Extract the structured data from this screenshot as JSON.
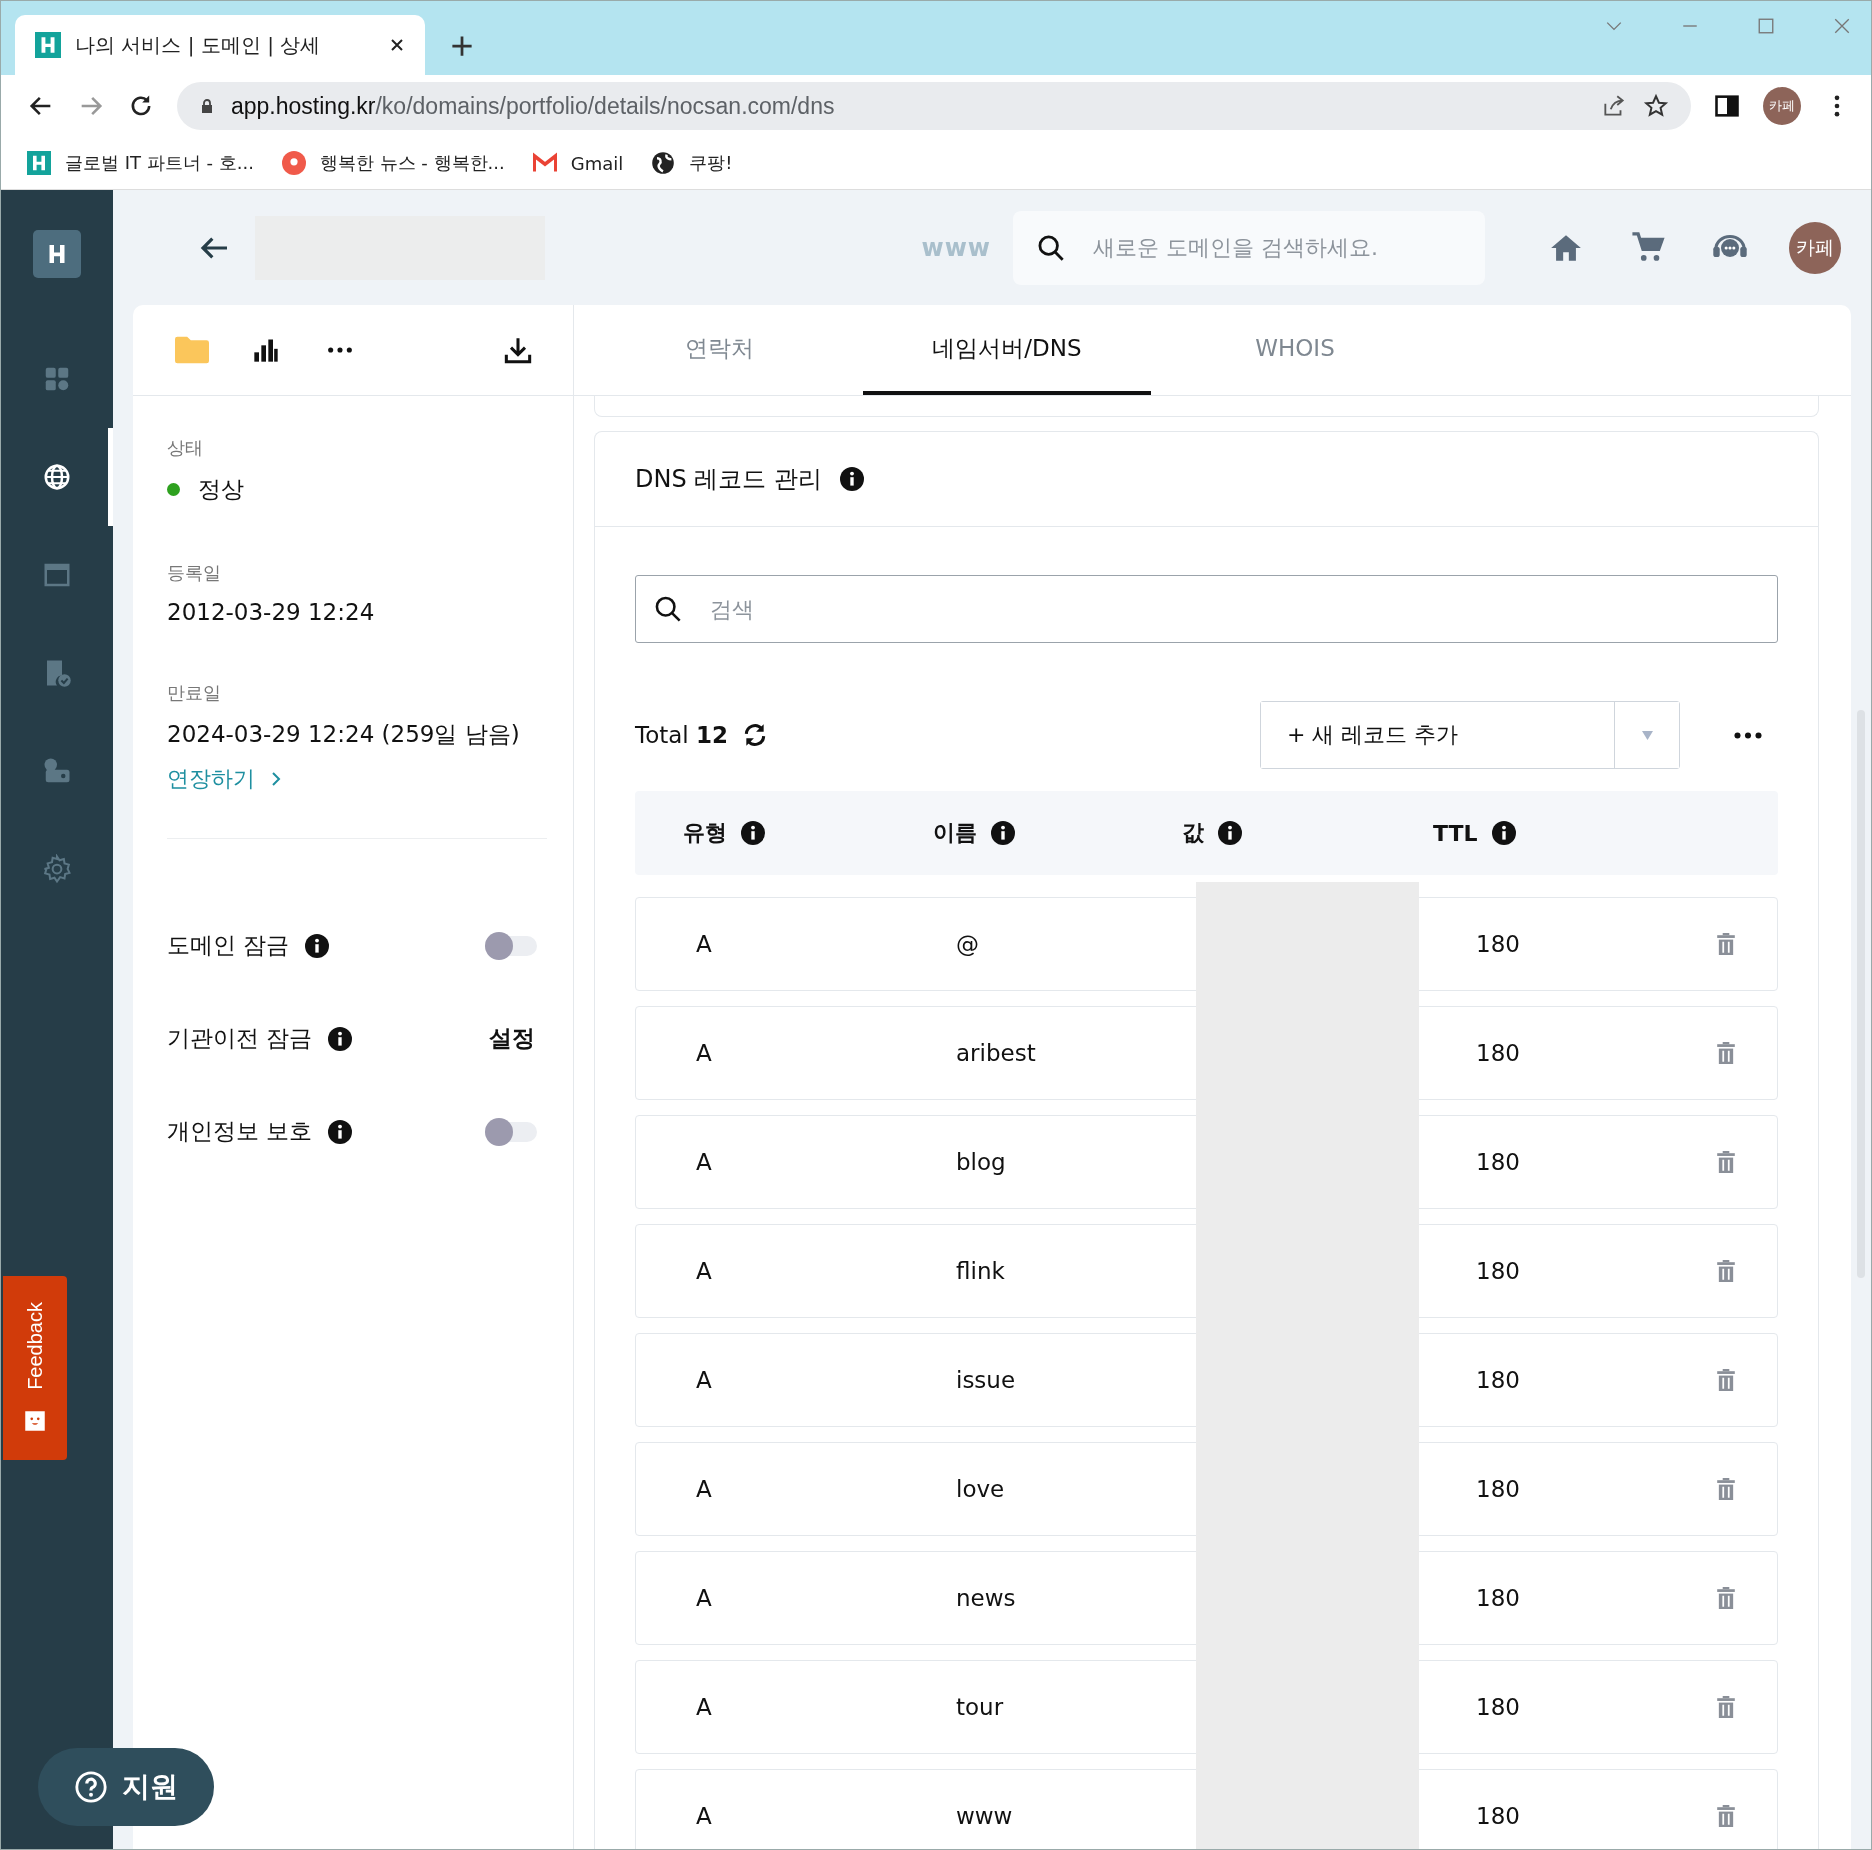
{
  "browser": {
    "tab_title": "나의 서비스 | 도메인 | 상세",
    "url_host": "app.hosting.kr",
    "url_path": "/ko/domains/portfolio/details/nocsan.com/dns",
    "profile": "카페",
    "bookmarks": [
      "글로벌 IT 파트너 - 호...",
      "행복한 뉴스 - 행복한...",
      "Gmail",
      "쿠팡!"
    ]
  },
  "nav_items": [
    {
      "selected": false
    },
    {
      "selected": true
    },
    {
      "selected": false
    },
    {
      "selected": false
    },
    {
      "selected": false
    },
    {
      "selected": false
    }
  ],
  "header": {
    "www_label": "www",
    "search_placeholder": "새로운 도메인을 검색하세요.",
    "avatar": "카페"
  },
  "summary": {
    "status_label": "상태",
    "status_value": "정상",
    "registered_label": "등록일",
    "registered_value": "2012-03-29 12:24",
    "expiry_label": "만료일",
    "expiry_value": "2024-03-29 12:24 (259일 남음)",
    "renew_link": "연장하기"
  },
  "settings": [
    {
      "label": "도메인 잠금",
      "kind": "toggle",
      "on": false
    },
    {
      "label": "기관이전 잠금",
      "kind": "action",
      "action": "설정"
    },
    {
      "label": "개인정보 보호",
      "kind": "toggle",
      "on": false
    }
  ],
  "tabs": [
    {
      "label": "연락처",
      "selected": false
    },
    {
      "label": "네임서버/DNS",
      "selected": true
    },
    {
      "label": "WHOIS",
      "selected": false
    }
  ],
  "dns": {
    "title": "DNS 레코드 관리",
    "search_placeholder": "검색",
    "total_label": "Total",
    "total_count": "12",
    "add_button": "+ 새 레코드 추가",
    "columns": [
      "유형",
      "이름",
      "값",
      "TTL"
    ],
    "rows": [
      {
        "type": "A",
        "name": "@",
        "ttl": "180"
      },
      {
        "type": "A",
        "name": "aribest",
        "ttl": "180"
      },
      {
        "type": "A",
        "name": "blog",
        "ttl": "180"
      },
      {
        "type": "A",
        "name": "flink",
        "ttl": "180"
      },
      {
        "type": "A",
        "name": "issue",
        "ttl": "180"
      },
      {
        "type": "A",
        "name": "love",
        "ttl": "180"
      },
      {
        "type": "A",
        "name": "news",
        "ttl": "180"
      },
      {
        "type": "A",
        "name": "tour",
        "ttl": "180"
      },
      {
        "type": "A",
        "name": "www",
        "ttl": "180"
      }
    ]
  },
  "feedback": "Feedback",
  "support": "지원"
}
